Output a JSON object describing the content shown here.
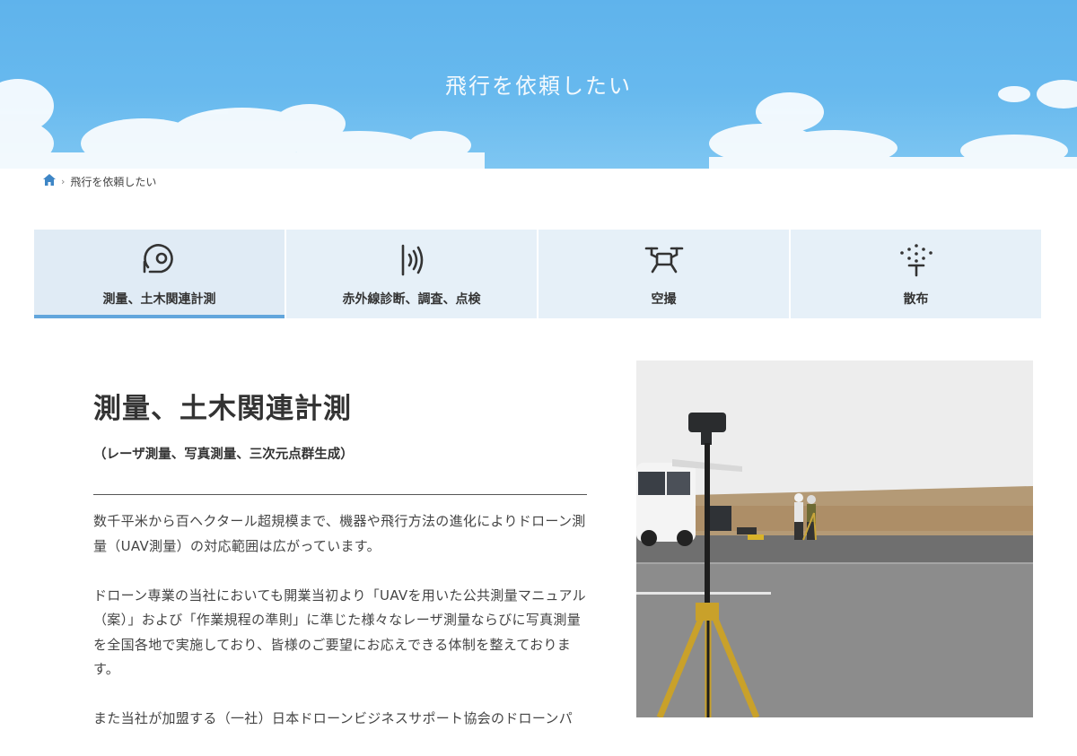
{
  "page": {
    "title": "飛行を依頼したい"
  },
  "breadcrumb": {
    "home_icon": "home-icon",
    "current": "飛行を依頼したい"
  },
  "tabs": [
    {
      "label": "測量、土木関連計測",
      "icon": "survey-icon",
      "active": true
    },
    {
      "label": "赤外線診断、調査、点検",
      "icon": "infrared-signal-icon",
      "active": false
    },
    {
      "label": "空撮",
      "icon": "drone-icon",
      "active": false
    },
    {
      "label": "散布",
      "icon": "spray-nozzle-icon",
      "active": false
    }
  ],
  "section": {
    "heading": "測量、土木関連計測",
    "subheading": "（レーザ測量、写真測量、三次元点群生成）",
    "paragraphs": [
      "数千平米から百ヘクタール超規模まで、機器や飛行方法の進化によりドローン測量（UAV測量）の対応範囲は広がっています。",
      "ドローン専業の当社においても開業当初より「UAVを用いた公共測量マニュアル（案）」および「作業規程の準則」に準じた様々なレーザ測量ならびに写真測量を全国各地で実施しており、皆様のご要望にお応えできる体制を整えております。",
      "また当社が加盟する（一社）日本ドローンビジネスサポート協会のドローンパ"
    ]
  },
  "colors": {
    "accent": "#62a6dc",
    "tab_bg": "#e6f0f8",
    "sky": "#5fb3ec",
    "text": "#333333"
  }
}
